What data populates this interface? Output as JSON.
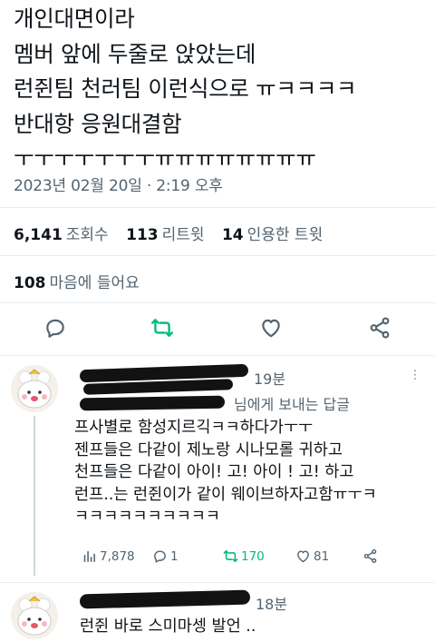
{
  "tweet": {
    "lines": [
      "개인대면이라",
      "멤버 앞에 두줄로 앉았는데",
      "런쥔팀 천러팀 이런식으로 ㅠㅋㅋㅋㅋ",
      "반대항 응원대결함",
      "ㅜㅜㅜㅜㅜㅜㅜㅠㅠㅠㅠㅠㅠㅠㅠ"
    ],
    "timestamp": "2023년 02월 20일 · 2:19 오후"
  },
  "stats": {
    "views_count": "6,141",
    "views_label": "조회수",
    "retweets_count": "113",
    "retweets_label": "리트윗",
    "quotes_count": "14",
    "quotes_label": "인용한 트윗",
    "likes_count": "108",
    "likes_label": "마음에 들어요"
  },
  "actions": {
    "icons": [
      "reply-icon",
      "retweet-icon",
      "like-icon",
      "share-icon"
    ],
    "retweet_color": "#00ba7c",
    "icon_color": "#536471"
  },
  "replies": [
    {
      "time": "19분",
      "reply_to_suffix": "님에게 보내는 답글",
      "lines": [
        "프사별로 함성지르긱ㅋㅋ하다가ㅜㅜ",
        "젠프들은 다같이 제노랑 시나모롤 귀하고",
        "천프들은 다같이 아이! 고! 아이 ! 고! 하고",
        "런프..는 런쥔이가 같이 웨이브하자고함ㅠㅜㅋ",
        "ㅋㅋㅋㅋㅋㅋㅋㅋㅋㅋ"
      ],
      "metrics": {
        "views": "7,878",
        "replies": "1",
        "retweets": "170",
        "likes": "81"
      }
    },
    {
      "time": "18분",
      "lines": [
        "런쥔 바로 스미마셍 발언 .."
      ]
    }
  ],
  "more_label": "⋮"
}
